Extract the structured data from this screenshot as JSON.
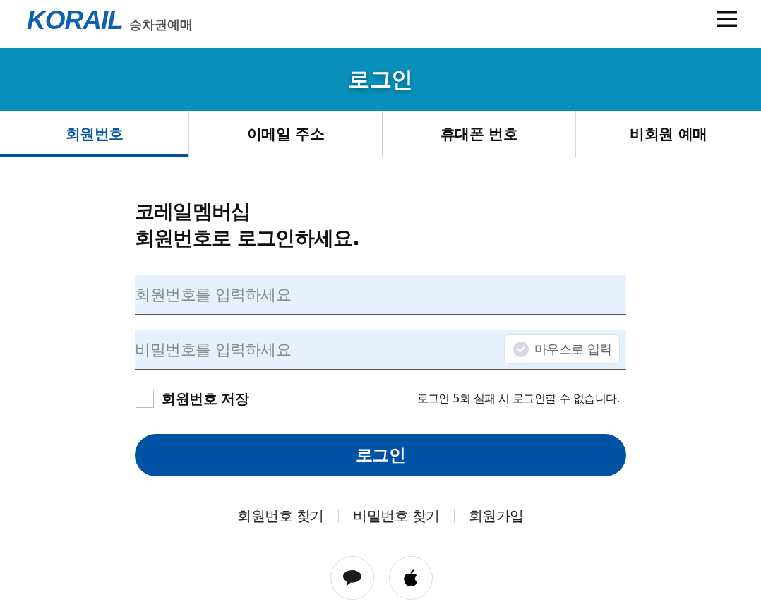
{
  "header": {
    "logo": {
      "brand": "KORAIL",
      "subtitle": "승차권예매"
    }
  },
  "banner": {
    "title": "로그인"
  },
  "tabs": [
    {
      "label": "회원번호",
      "selected": true
    },
    {
      "label": "이메일 주소",
      "selected": false
    },
    {
      "label": "휴대폰 번호",
      "selected": false
    },
    {
      "label": "비회원 예매",
      "selected": false
    }
  ],
  "form": {
    "heading": "코레일멤버십\n회원번호로 로그인하세요.",
    "fields": [
      {
        "placeholder": "회원번호를 입력하세요"
      },
      {
        "placeholder": "비밀번호를 입력하세요",
        "mouse_input": {
          "label": "마우스로 입력",
          "on": false
        }
      }
    ],
    "remember": {
      "label": "회원번호 저장",
      "checked": false
    },
    "notice": "로그인 5회 실패 시 로그인할 수 없습니다.",
    "submit": "로그인",
    "links": [
      "회원번호 찾기",
      "비밀번호 찾기",
      "회원가입"
    ],
    "social": [
      {
        "kind": "chat"
      },
      {
        "kind": "apple"
      }
    ]
  }
}
